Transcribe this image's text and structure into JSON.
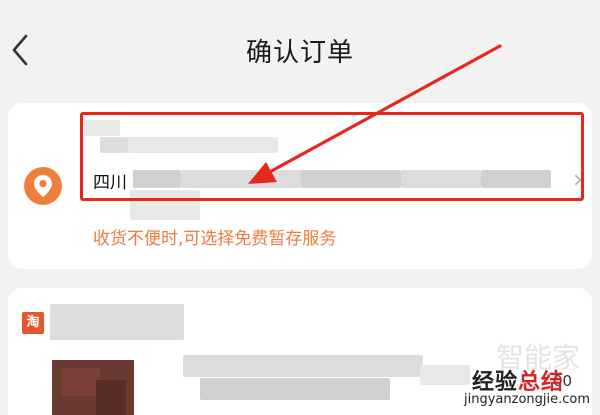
{
  "header": {
    "title": "确认订单",
    "back_icon": "chevron-left-icon"
  },
  "address": {
    "province": "四川",
    "hint": "收货不便时,可选择免费暂存服务",
    "hint_color": "#ef7b3a",
    "pin_icon": "location-pin-icon",
    "pin_color": "#ee7f3b"
  },
  "shop": {
    "badge": "淘",
    "badge_color": "#e5562d",
    "price_fragment": "00"
  },
  "watermark": {
    "brand_part1": "经验",
    "brand_part2": "总结",
    "url": "jingyanzongjie.com",
    "faint": "智能家"
  },
  "annotation": {
    "highlight_color": "#e8261c"
  }
}
